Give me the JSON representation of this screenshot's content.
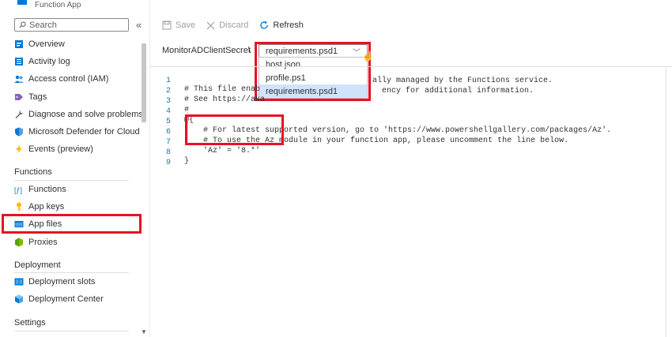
{
  "app": {
    "subtitle": "Function App"
  },
  "sidebar": {
    "search_placeholder": "Search",
    "collapse_label": "«",
    "items_top": [
      {
        "label": "Overview",
        "icon": "overview-icon"
      },
      {
        "label": "Activity log",
        "icon": "activity-log-icon"
      },
      {
        "label": "Access control (IAM)",
        "icon": "people-icon"
      },
      {
        "label": "Tags",
        "icon": "tag-icon"
      },
      {
        "label": "Diagnose and solve problems",
        "icon": "wrench-icon"
      },
      {
        "label": "Microsoft Defender for Cloud",
        "icon": "shield-icon"
      },
      {
        "label": "Events (preview)",
        "icon": "lightning-icon"
      }
    ],
    "sections": {
      "functions": "Functions",
      "deployment": "Deployment",
      "settings": "Settings"
    },
    "functions_items": [
      {
        "label": "Functions",
        "icon": "function-icon"
      },
      {
        "label": "App keys",
        "icon": "key-icon"
      },
      {
        "label": "App files",
        "icon": "app-files-icon"
      },
      {
        "label": "Proxies",
        "icon": "proxy-icon"
      }
    ],
    "deployment_items": [
      {
        "label": "Deployment slots",
        "icon": "slots-icon"
      },
      {
        "label": "Deployment Center",
        "icon": "cube-icon"
      }
    ]
  },
  "toolbar": {
    "save": "Save",
    "discard": "Discard",
    "refresh": "Refresh"
  },
  "path": {
    "function_name": "MonitorADClientSecret",
    "separator": "\\",
    "selected_file": "requirements.psd1",
    "options": [
      "host.json",
      "profile.ps1",
      "requirements.psd1"
    ]
  },
  "editor": {
    "lines": [
      {
        "n": "1",
        "text": "# This file enab"
      },
      {
        "n": "2",
        "text": "# See https://aka"
      },
      {
        "n": "3",
        "text": "#"
      },
      {
        "n": "4",
        "text": "@{"
      },
      {
        "n": "5",
        "text": "    # For latest supported version, go to 'https://www.powershellgallery.com/packages/Az'."
      },
      {
        "n": "6",
        "text": "    # To use the Az module in your function app, please uncomment the line below."
      },
      {
        "n": "7",
        "text": "    'Az' = '8.*'"
      },
      {
        "n": "8",
        "text": "}"
      },
      {
        "n": "9",
        "text": ""
      }
    ],
    "line1_tail": "ally managed by the Functions service.",
    "line2_tail": "ency for additional information."
  },
  "colors": {
    "accent": "#0078d4",
    "highlight": "#e81123",
    "selected_option": "#cfe4fa"
  }
}
